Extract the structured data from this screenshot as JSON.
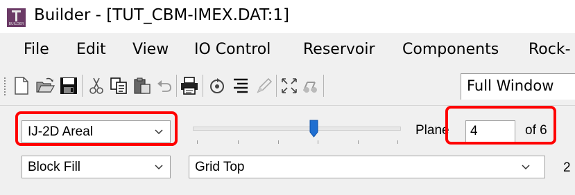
{
  "window": {
    "app_icon_text": "BUILDER",
    "title": "Builder - [TUT_CBM-IMEX.DAT:1]"
  },
  "menubar": {
    "items": [
      "File",
      "Edit",
      "View",
      "IO Control",
      "Reservoir",
      "Components",
      "Rock-"
    ]
  },
  "toolbar": {
    "icons": [
      "new-file-icon",
      "open-folder-icon",
      "save-icon",
      "cut-icon",
      "copy-icon",
      "paste-icon",
      "undo-icon",
      "print-icon",
      "rotate-icon",
      "align-icon",
      "pencil-icon",
      "fit-view-icon",
      "probe-icon"
    ],
    "view_combo_value": "Full Window"
  },
  "panel": {
    "view_type_value": "IJ-2D Areal",
    "fill_mode_value": "Block Fill",
    "grid_value": "Grid Top",
    "plane_label": "Plane",
    "plane_value": "4",
    "plane_of": "of 6",
    "plane_current": 4,
    "plane_total": 6,
    "cut_off_text": "2"
  },
  "colors": {
    "highlight": "#ff0000",
    "slider_thumb": "#1f6fd1",
    "app_icon_bg": "#6b3a66"
  }
}
